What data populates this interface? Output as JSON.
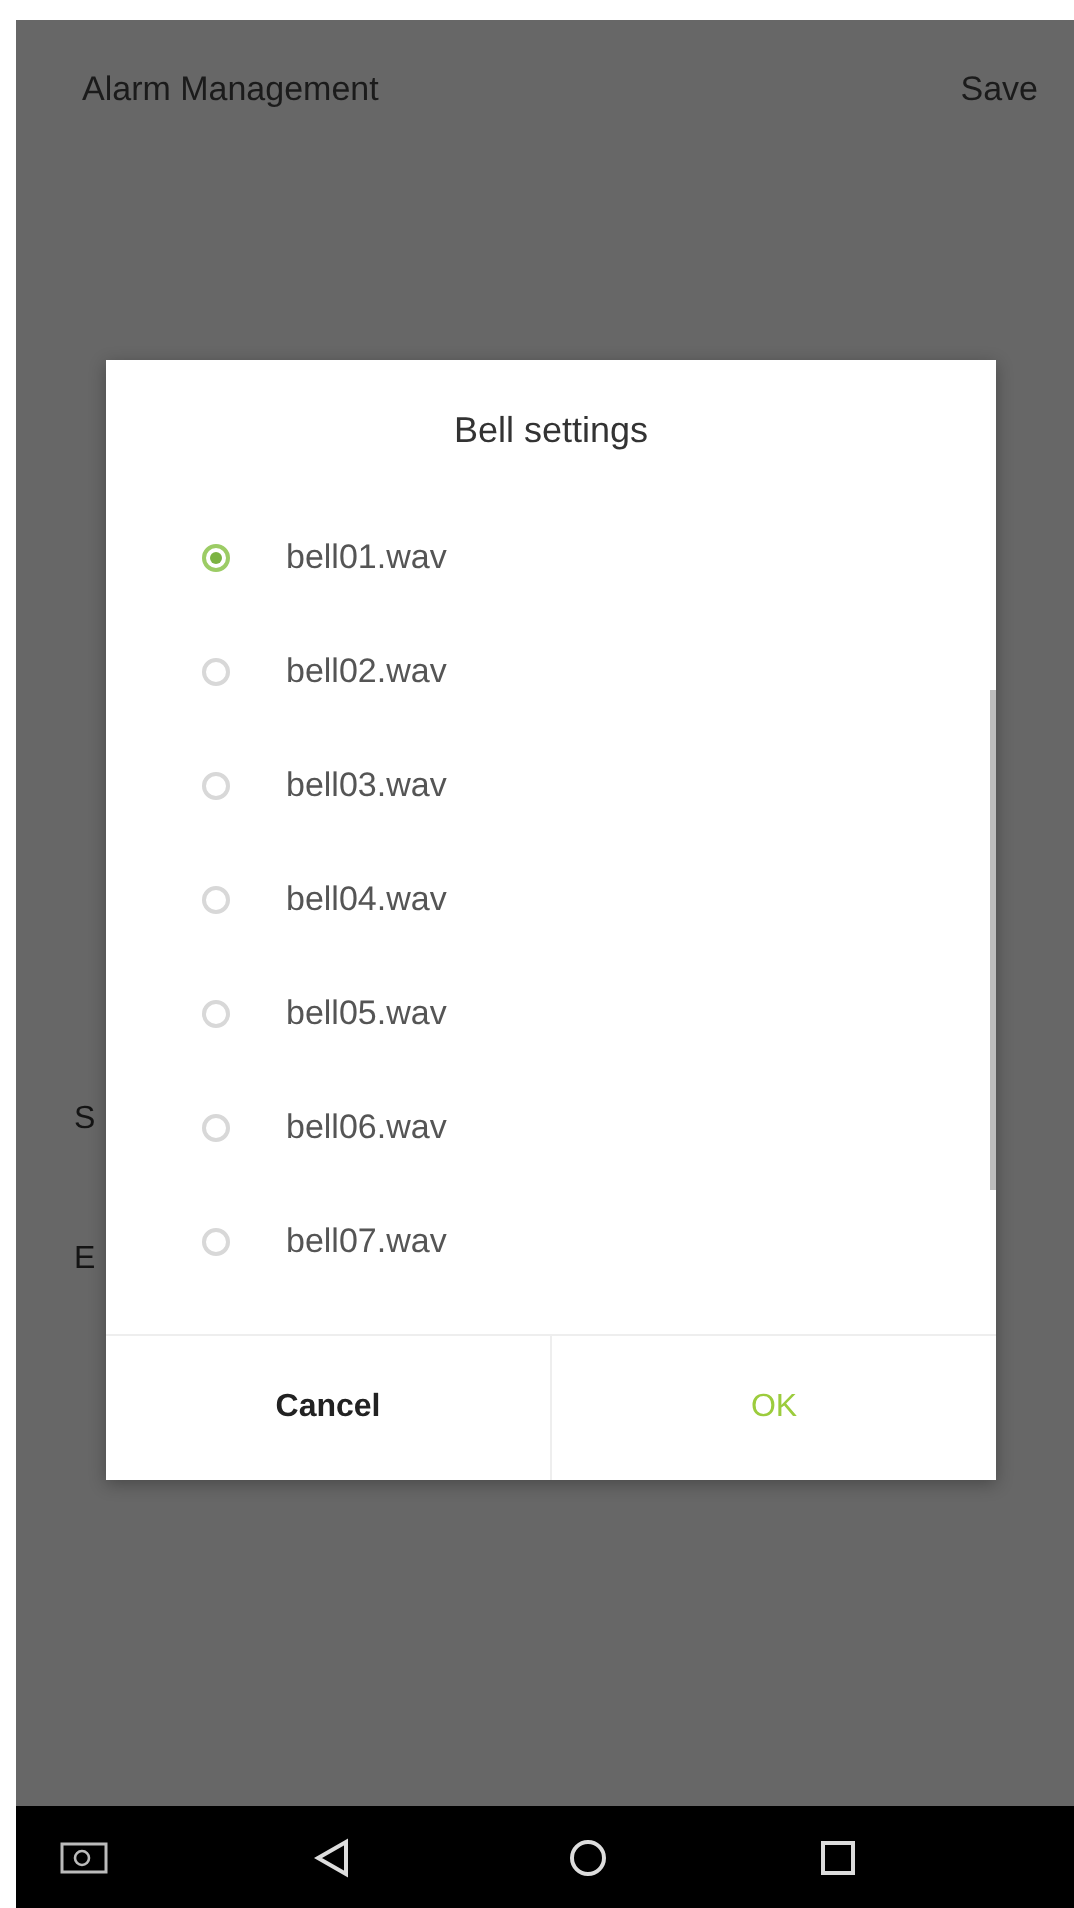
{
  "header": {
    "title": "Alarm Management",
    "action": "Save"
  },
  "background_rows": [
    "S",
    "E"
  ],
  "dialog": {
    "title": "Bell settings",
    "options": [
      {
        "label": "bell01.wav",
        "selected": true
      },
      {
        "label": "bell02.wav",
        "selected": false
      },
      {
        "label": "bell03.wav",
        "selected": false
      },
      {
        "label": "bell04.wav",
        "selected": false
      },
      {
        "label": "bell05.wav",
        "selected": false
      },
      {
        "label": "bell06.wav",
        "selected": false
      },
      {
        "label": "bell07.wav",
        "selected": false
      }
    ],
    "buttons": [
      {
        "label": "Cancel",
        "kind": "neutral"
      },
      {
        "label": "OK",
        "kind": "primary"
      }
    ]
  }
}
